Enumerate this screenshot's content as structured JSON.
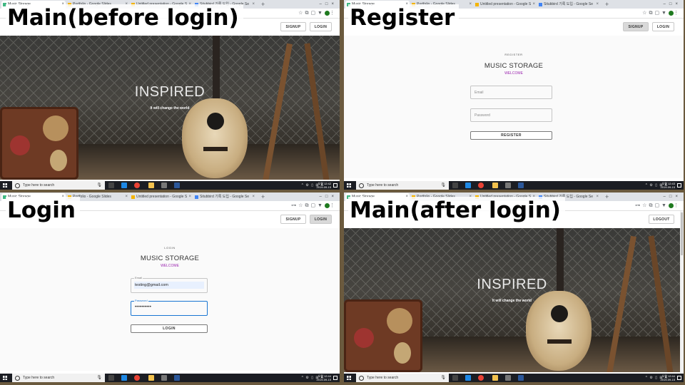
{
  "panels": {
    "main_before": {
      "label": "Main(before login)",
      "tabs": [
        "Music Storage",
        "Portfolio - Google Slides",
        "Untitled presentation - Google S",
        "Situbbird 기록 도입 - Google Se"
      ],
      "buttons": {
        "signup": "SIGNUP",
        "login": "LOGIN"
      },
      "hero": {
        "title": "INSPIRED",
        "subtitle": "It will change the world"
      },
      "taskbar": {
        "search": "Type here to search",
        "time": "오전 12:42",
        "date": "2019-09-15"
      }
    },
    "register": {
      "label": "Register",
      "tabs": [
        "Music Storage",
        "Portfolio - Google Slides",
        "Untitled presentation - Google S",
        "Situbbird 기록 도입 - Google Se"
      ],
      "buttons": {
        "signup": "SIGNUP",
        "login": "LOGIN"
      },
      "card": {
        "heading": "REGISTER",
        "title": "MUSIC STORAGE",
        "welcome": "WELCOME",
        "email_placeholder": "Email",
        "password_placeholder": "Password",
        "submit": "REGISTER"
      },
      "taskbar": {
        "search": "Type here to search",
        "time": "오전 12:43",
        "date": "2019-09-15"
      }
    },
    "login": {
      "label": "Login",
      "tabs": [
        "Music Storage",
        "Portfolio - Google Slides",
        "Untitled presentation - Google S",
        "Situbbird 기록 도입 - Google Se"
      ],
      "buttons": {
        "signup": "SIGNUP",
        "login": "LOGIN"
      },
      "card": {
        "heading": "LOGIN",
        "title": "MUSIC STORAGE",
        "welcome": "WELCOME",
        "email_label": "Email",
        "email_value": "testing@gmail.com",
        "password_label": "Password",
        "password_value": "••••••••••",
        "submit": "LOGIN"
      },
      "taskbar": {
        "search": "Type here to search",
        "time": "오전 12:44",
        "date": "2019-09-15"
      }
    },
    "main_after": {
      "label": "Main(after login)",
      "tabs": [
        "Music Storage",
        "Portfolio - Google Slides",
        "Untitled presentation - Google S",
        "Situbbird 기록 도입 - Google Se"
      ],
      "buttons": {
        "logout": "LOGOUT"
      },
      "hero": {
        "title": "INSPIRED",
        "subtitle": "It will change the world"
      },
      "taskbar": {
        "search": "Type here to search",
        "time": "오전 12:44",
        "date": "2019-09-15"
      }
    }
  },
  "colors": {
    "accent_purple": "#9c27b0",
    "focus_blue": "#1976d2",
    "taskbar": "#1b1d23"
  }
}
